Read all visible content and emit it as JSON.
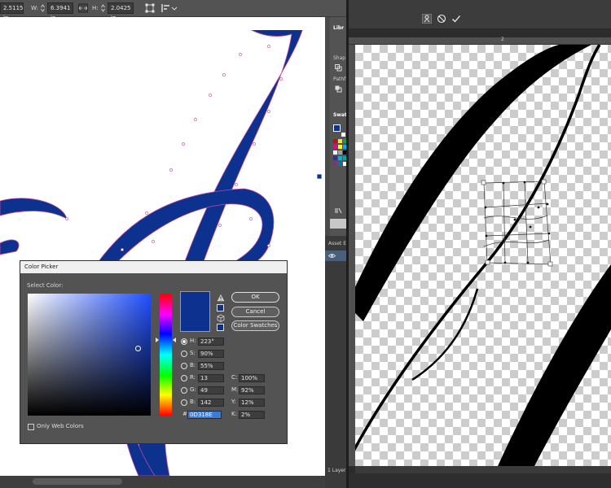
{
  "ai_toolbar": {
    "x_value": "2.5115 in",
    "w_label": "W:",
    "w_value": "6.3941 in",
    "h_label": "H:",
    "h_value": "2.0425 in"
  },
  "ai_panel": {
    "libraries_label": "Libr",
    "shape_label": "Shap",
    "pathfinder_label": "Pathf",
    "swatches_label": "Swat"
  },
  "asset_panel": {
    "label": "Asset Ex",
    "layers_count": "1 Layer"
  },
  "color_picker": {
    "title": "Color Picker",
    "select_color_label": "Select Color:",
    "new_color": "#0d318e",
    "ok_label": "OK",
    "cancel_label": "Cancel",
    "swatches_label": "Color Swatches",
    "only_web_label": "Only Web Colors",
    "h": {
      "label": "H:",
      "value": "223°"
    },
    "s": {
      "label": "S:",
      "value": "90%"
    },
    "b": {
      "label": "B:",
      "value": "55%"
    },
    "r": {
      "label": "R:",
      "value": "13"
    },
    "g": {
      "label": "G:",
      "value": "49"
    },
    "b2": {
      "label": "B:",
      "value": "142"
    },
    "c": {
      "label": "C:",
      "value": "100%"
    },
    "m": {
      "label": "M:",
      "value": "92%"
    },
    "y": {
      "label": "Y:",
      "value": "12%"
    },
    "k": {
      "label": "K:",
      "value": "2%"
    },
    "hex_label": "#",
    "hex_value": "0D318E"
  },
  "ps_ruler": {
    "mark": "2"
  },
  "colors": {
    "stroke_blue": "#0d318e",
    "path_pink": "#c04a9c",
    "ps_ink": "#000000"
  }
}
